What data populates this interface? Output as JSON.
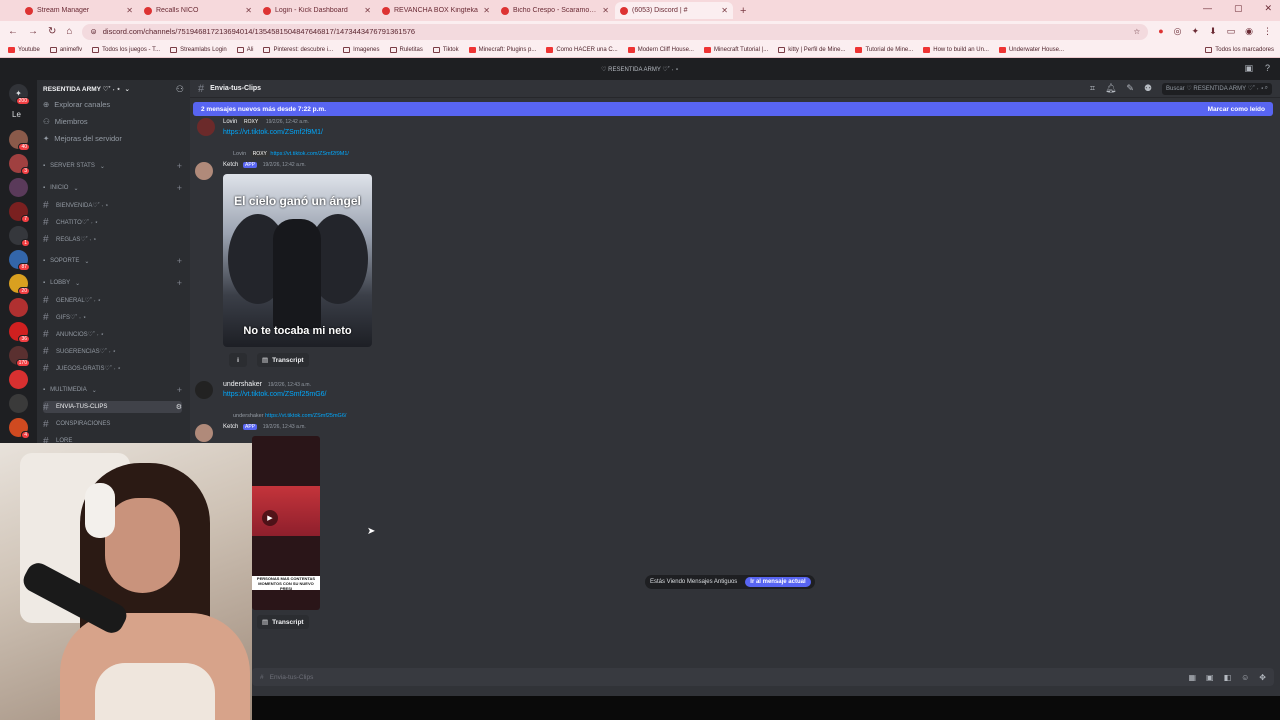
{
  "browser": {
    "tabs": [
      {
        "title": "Stream Manager",
        "active": false
      },
      {
        "title": "Recalls NICO",
        "active": false
      },
      {
        "title": "Login - Kick Dashboard",
        "active": false
      },
      {
        "title": "REVANCHA BOX Kingteka",
        "active": false
      },
      {
        "title": "Bicho Crespo - Scaramouche",
        "active": false
      },
      {
        "title": "(6053) Discord | #",
        "active": true
      }
    ],
    "url": "discord.com/channels/751946817213694014/1354581504847646817/1473443476791361576",
    "bookmarks": [
      "Youtube",
      "animeflv",
      "Todos los juegos - T...",
      "Streamlabs Login",
      "Ali",
      "Pinterest: descubre i...",
      "Imagenes",
      "Ruletitas",
      "Tiktok",
      "Minecraft: Plugins p...",
      "Como HACER una C...",
      "Modern Cliff House...",
      "Minecraft Tutorial |...",
      "kitty | Perfil de Mine...",
      "Tutorial de Mine...",
      "How to build an Un...",
      "Underwater House..."
    ],
    "bookmarks_right": "Todos los marcadores"
  },
  "discord": {
    "server_title": "♡ RESENTIDA ARMY ♡˚ ˖ ⋆",
    "server_name": "RESENTIDA ARMY ♡˚ ˖ ⋆",
    "user_initials": "Le",
    "guild_badges": [
      "200",
      "40",
      "3",
      "",
      "7",
      "1",
      "87",
      "20",
      "",
      "36",
      "170",
      "",
      "",
      "4"
    ],
    "top_items": [
      "Explorar canales",
      "Miembros",
      "Mejoras del servidor"
    ],
    "channels": [
      {
        "type": "cat",
        "label": "SERVER STATS"
      },
      {
        "type": "cat",
        "label": "INICIO"
      },
      {
        "type": "ch",
        "label": "BIENVENIDA♡˚ ˖ ⋆"
      },
      {
        "type": "ch",
        "label": "CHATITO♡˚ ˖ ⋆"
      },
      {
        "type": "ch",
        "label": "REGLAS♡˚ ˖ ⋆"
      },
      {
        "type": "cat",
        "label": "SOPORTE"
      },
      {
        "type": "cat",
        "label": "LOBBY"
      },
      {
        "type": "ch",
        "label": "GENERAL♡˚ ˖ ⋆"
      },
      {
        "type": "ch",
        "label": "GIFS♡˚ ˖ ⋆"
      },
      {
        "type": "ch",
        "label": "ANUNCIOS♡˚ ˖ ⋆"
      },
      {
        "type": "ch",
        "label": "SUGERENCIAS♡˚ ˖ ⋆"
      },
      {
        "type": "ch",
        "label": "JUEGOS-GRATIS♡˚ ˖ ⋆"
      },
      {
        "type": "cat",
        "label": "MULTIMEDIA"
      },
      {
        "type": "ch",
        "label": "ENVIA-TUS-CLIPS",
        "selected": true
      },
      {
        "type": "ch",
        "label": "CONSPIRACIONES"
      },
      {
        "type": "ch",
        "label": "LORE"
      }
    ],
    "channel_title": "Envia-tus-Clips",
    "search_placeholder": "Buscar ♡ RESENTIDA ARMY ♡˚ ˖ ⋆",
    "new_messages": "2 mensajes nuevos más desde 7:22 p.m.",
    "mark_read": "Marcar como leído",
    "messages": {
      "m1": {
        "user": "Lovin",
        "tag": "ROXY",
        "time": "19/2/26, 12:42 a.m.",
        "link": "https://vt.tiktok.com/ZSmf2f9M1/"
      },
      "m2": {
        "reply_user": "Lovin",
        "reply_tag": "ROXY",
        "reply_link": "https://vt.tiktok.com/ZSmf2f9M1/",
        "user": "Ketch",
        "app": "APP",
        "time": "19/2/26, 12:42 a.m.",
        "img_top": "El cielo ganó un ángel",
        "img_bottom": "No te tocaba mi neto",
        "transcript": "Transcript"
      },
      "m3": {
        "user": "undershaker",
        "time": "19/2/26, 12:43 a.m.",
        "link": "https://vt.tiktok.com/ZSmf25mG6/"
      },
      "m4": {
        "reply_user": "undershaker",
        "reply_link": "https://vt.tiktok.com/ZSmf25mG6/",
        "user": "Ketch",
        "app": "APP",
        "time": "19/2/26, 12:43 a.m.",
        "vid_caption": "PERSONAS MAS CONTENTAS MOMENTOS CON SU NUEVO PRESI",
        "transcript": "Transcript"
      }
    },
    "old_messages": "Estás Viendo Mensajes Antiguos",
    "jump": "Ir al mensaje actual",
    "composer_placeholder": "Envia-tus-Clips"
  }
}
